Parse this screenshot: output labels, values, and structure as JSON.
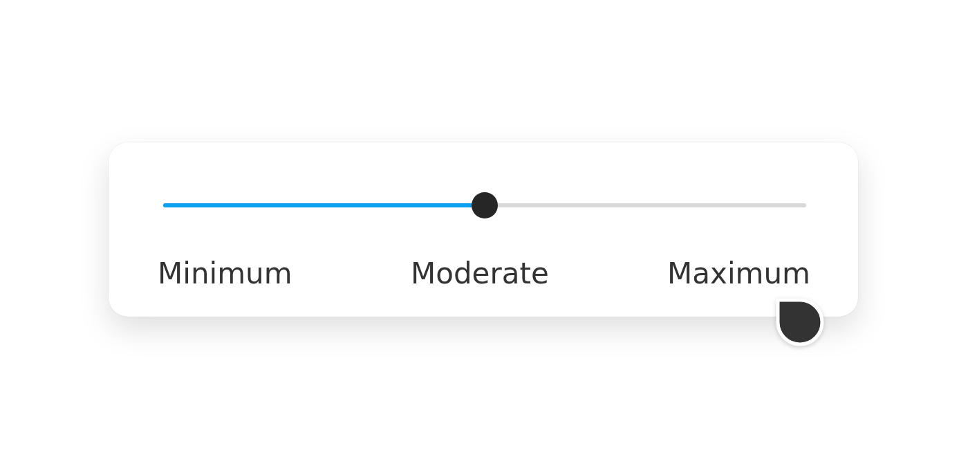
{
  "slider": {
    "level": 0.5,
    "labels": [
      "Minimum",
      "Moderate",
      "Maximum"
    ]
  }
}
